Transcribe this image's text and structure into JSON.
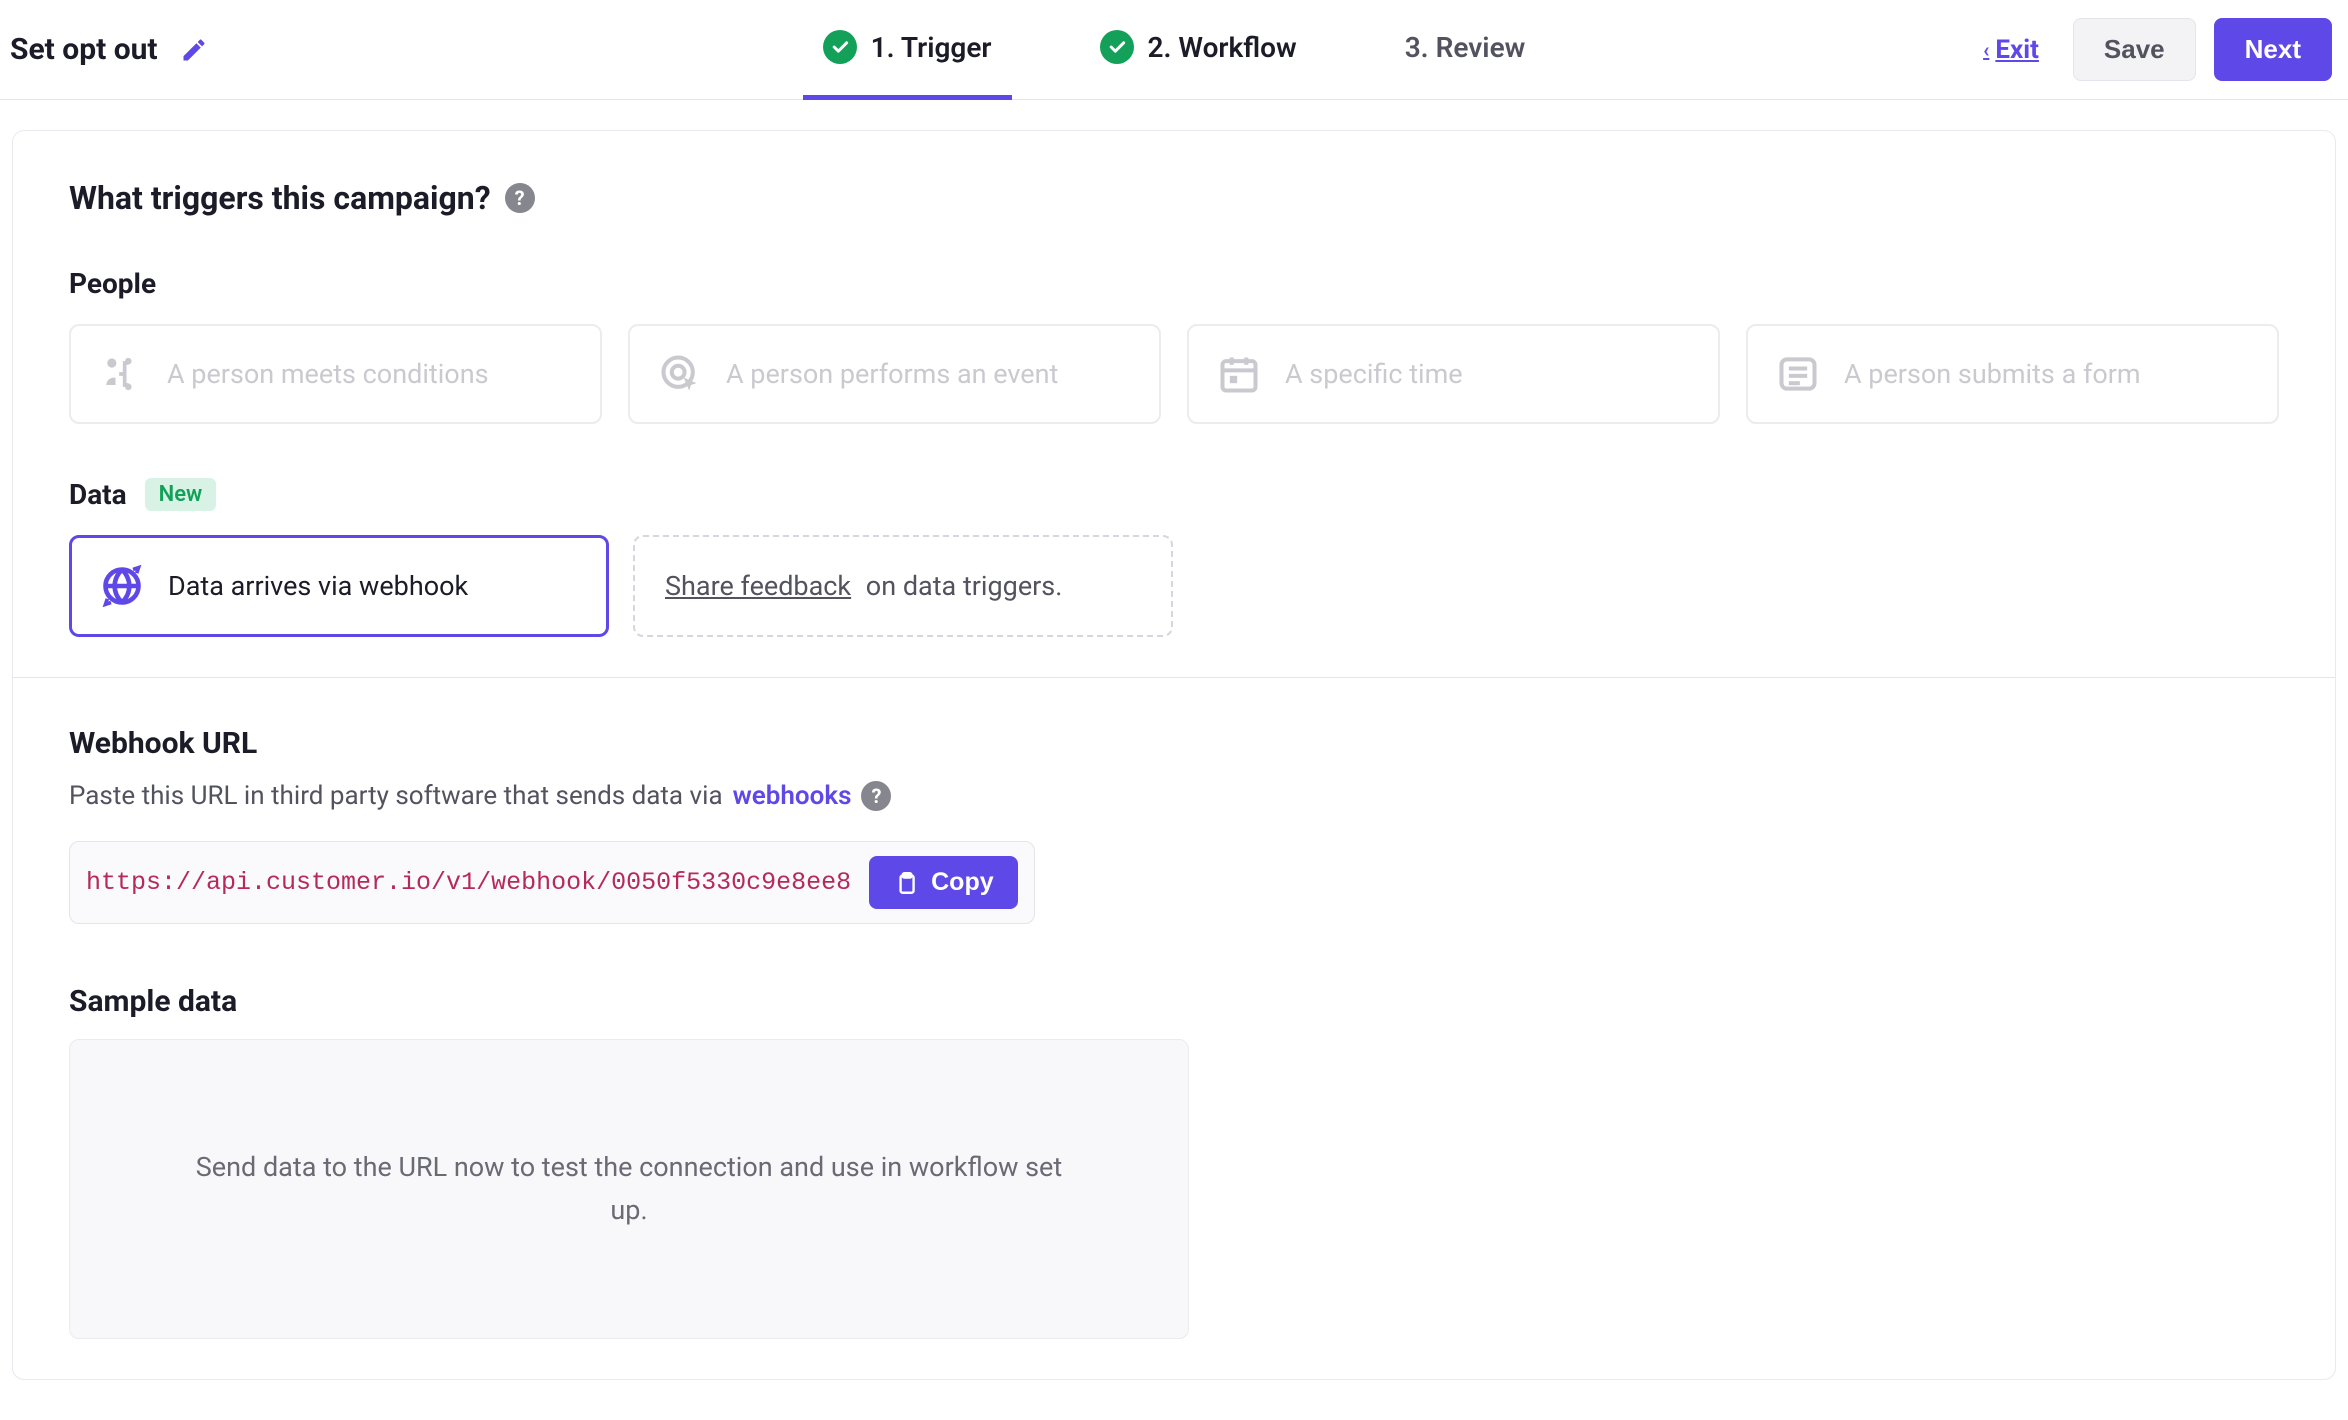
{
  "header": {
    "title": "Set opt out",
    "exit_label": "Exit",
    "save_label": "Save",
    "next_label": "Next",
    "steps": [
      {
        "label": "1. Trigger",
        "done": true,
        "active": true
      },
      {
        "label": "2. Workflow",
        "done": true
      },
      {
        "label": "3. Review"
      }
    ]
  },
  "trigger": {
    "heading": "What triggers this campaign?",
    "people_label": "People",
    "people_options": [
      "A person meets conditions",
      "A person performs an event",
      "A specific time",
      "A person submits a form"
    ],
    "data_label": "Data",
    "new_badge": "New",
    "data_option": "Data arrives via webhook",
    "feedback_link": "Share feedback",
    "feedback_rest": " on data triggers."
  },
  "webhook": {
    "heading": "Webhook URL",
    "desc_prefix": "Paste this URL in third party software that sends data via ",
    "desc_link": "webhooks",
    "url": "https://api.customer.io/v1/webhook/0050f5330c9e8ee8",
    "copy_label": "Copy"
  },
  "sample": {
    "heading": "Sample data",
    "empty_text": "Send data to the URL now to test the connection and use in workflow set up."
  }
}
